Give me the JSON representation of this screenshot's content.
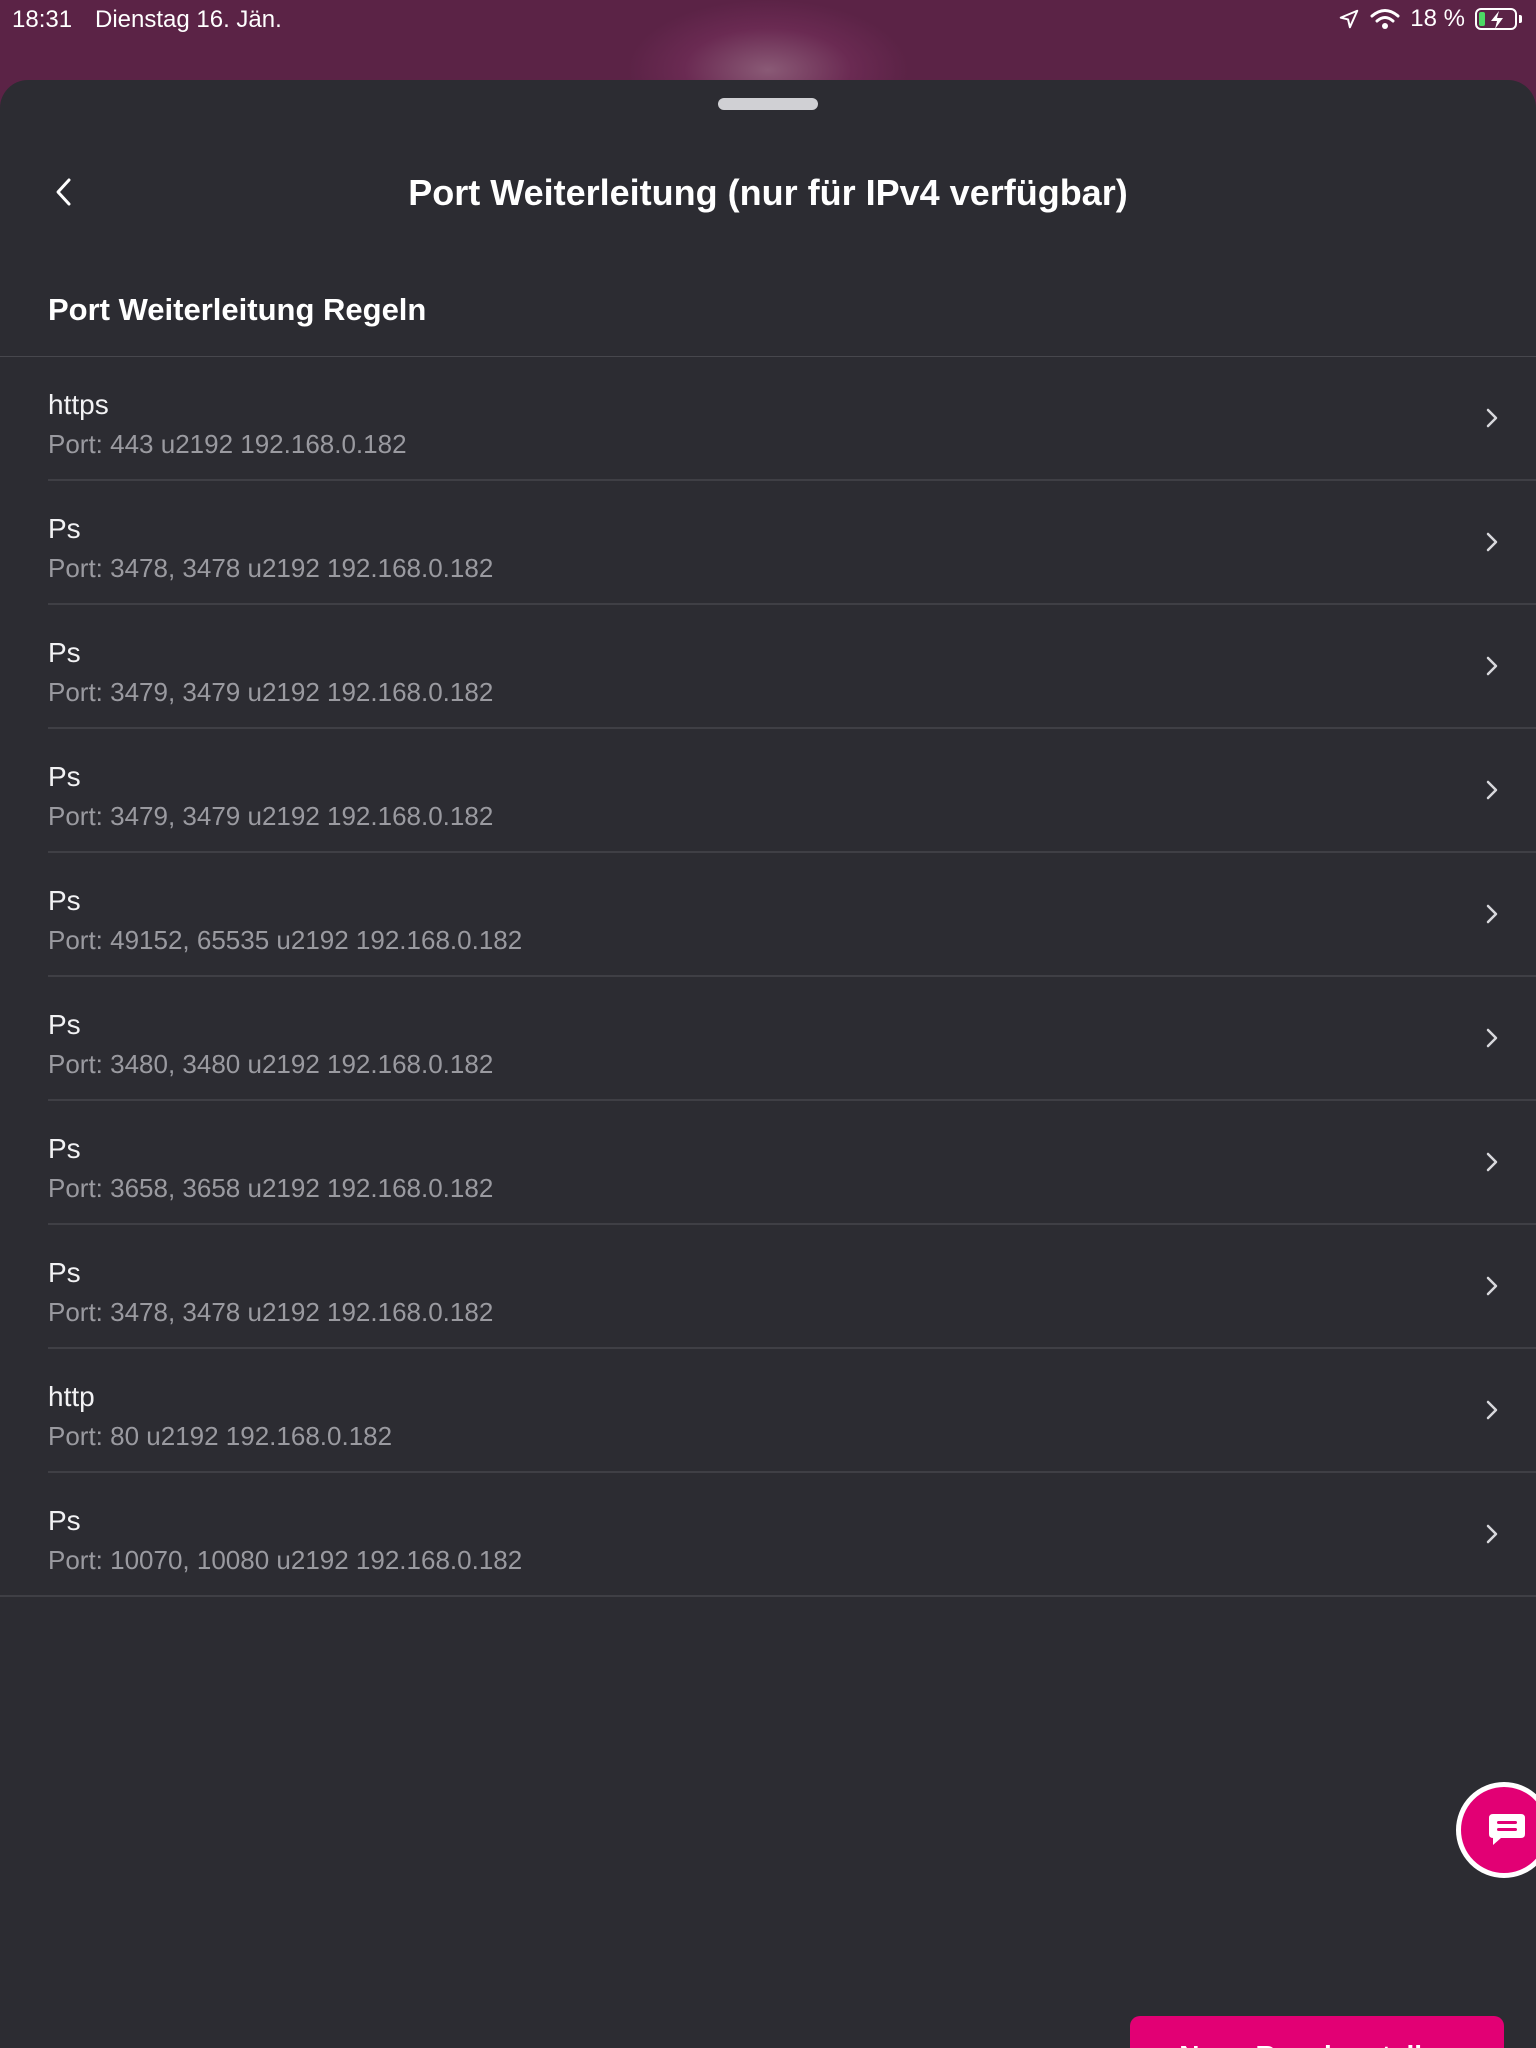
{
  "status_bar": {
    "time": "18:31",
    "date": "Dienstag 16. Jän.",
    "battery_text": "18 %",
    "battery_level": 0.18,
    "icons": [
      "location-arrow-icon",
      "wifi-icon",
      "battery-charging-icon"
    ]
  },
  "header": {
    "back_icon": "chevron-left-icon",
    "title": "Port Weiterleitung (nur für IPv4 verfügbar)"
  },
  "section": {
    "title": "Port Weiterleitung Regeln"
  },
  "rules": [
    {
      "name": "https",
      "detail": "Port: 443  u2192  192.168.0.182"
    },
    {
      "name": "Ps",
      "detail": "Port: 3478, 3478  u2192  192.168.0.182"
    },
    {
      "name": "Ps",
      "detail": "Port: 3479, 3479  u2192  192.168.0.182"
    },
    {
      "name": "Ps",
      "detail": "Port: 3479, 3479  u2192  192.168.0.182"
    },
    {
      "name": "Ps",
      "detail": "Port: 49152, 65535  u2192  192.168.0.182"
    },
    {
      "name": "Ps",
      "detail": "Port: 3480, 3480  u2192  192.168.0.182"
    },
    {
      "name": "Ps",
      "detail": "Port: 3658, 3658  u2192  192.168.0.182"
    },
    {
      "name": "Ps",
      "detail": "Port: 3478, 3478  u2192  192.168.0.182"
    },
    {
      "name": "http",
      "detail": "Port: 80  u2192  192.168.0.182"
    },
    {
      "name": "Ps",
      "detail": "Port: 10070, 10080  u2192  192.168.0.182"
    }
  ],
  "chat_button": {
    "icon": "chat-bubble-icon"
  },
  "actions": {
    "create_rule_label": "Neue Regel erstellen"
  },
  "colors": {
    "accent": "#e20074",
    "sheet_background": "#2c2c32",
    "secondary_text": "#9a9aa0"
  }
}
